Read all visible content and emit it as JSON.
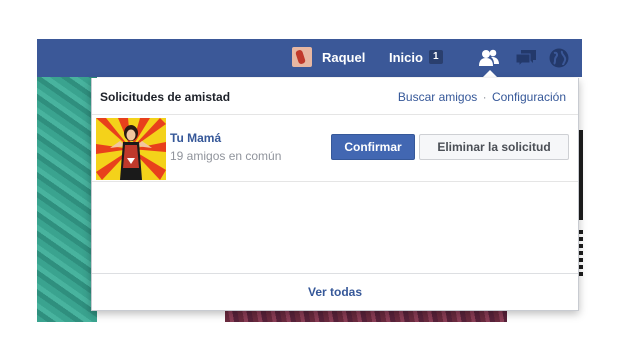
{
  "topbar": {
    "user_name": "Raquel",
    "home_label": "Inicio",
    "home_count": "1",
    "icons": [
      "avatar",
      "friends-icon",
      "messages-icon",
      "globe-icon"
    ]
  },
  "friend_requests": {
    "title": "Solicitudes de amistad",
    "find_friends_link": "Buscar amigos",
    "separator": "·",
    "settings_link": "Configuración",
    "requests": [
      {
        "name": "Tu Mamá",
        "mutual": "19 amigos en común",
        "confirm_label": "Confirmar",
        "delete_label": "Eliminar la solicitud"
      }
    ],
    "see_all_label": "Ver todas"
  },
  "colors": {
    "topbar": "#3b5898",
    "link": "#365899",
    "confirm_button": "#4267b2"
  }
}
